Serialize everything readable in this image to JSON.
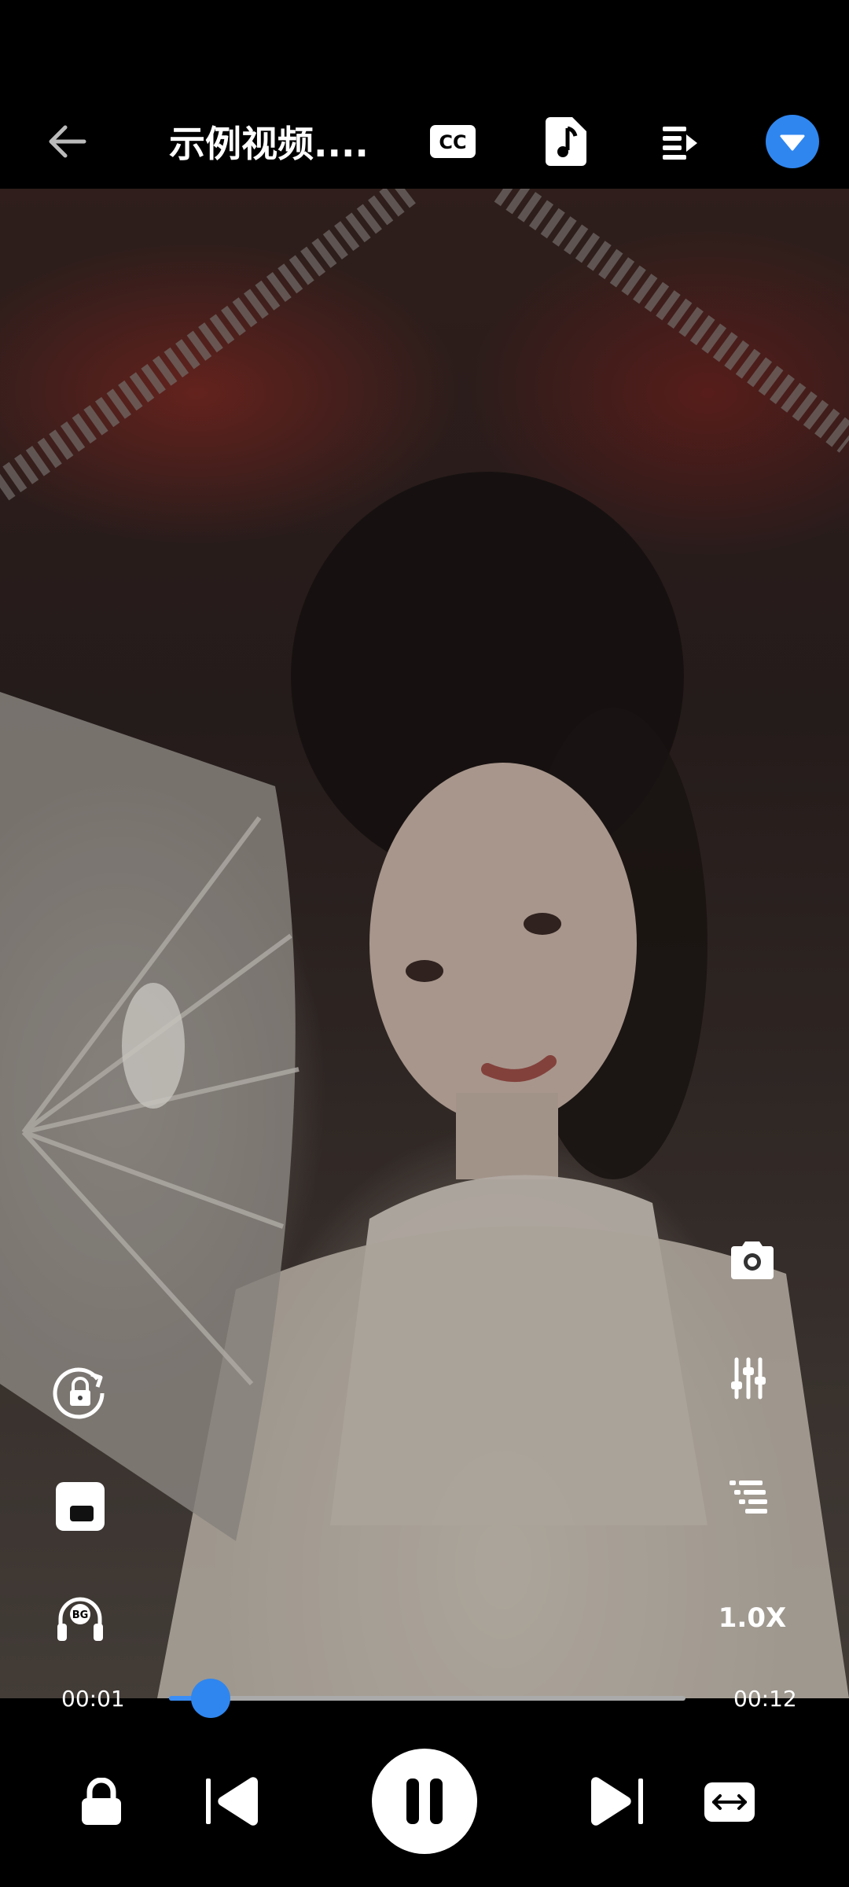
{
  "header": {
    "title": "示例视频....",
    "back_icon": "arrow-left-icon",
    "cc_label": "CC",
    "music_icon": "music-note-icon",
    "playlist_icon": "playlist-icon",
    "menu_icon": "chevron-down-circle-icon"
  },
  "side_controls": {
    "rotate_lock_icon": "rotate-lock-icon",
    "popup_icon": "pip-window-icon",
    "bg_play_label": "BG",
    "screenshot_icon": "camera-icon",
    "equalizer_icon": "equalizer-icon",
    "chapters_icon": "list-icon",
    "speed": "1.0X"
  },
  "progress": {
    "current": "00:01",
    "total": "00:12",
    "fraction": 0.08
  },
  "bottom_controls": {
    "lock_icon": "lock-icon",
    "previous_icon": "skip-previous-icon",
    "pause_icon": "pause-icon",
    "next_icon": "skip-next-icon",
    "aspect_icon": "aspect-ratio-icon"
  },
  "colors": {
    "accent": "#2f86ef",
    "bar_background": "#000000"
  }
}
